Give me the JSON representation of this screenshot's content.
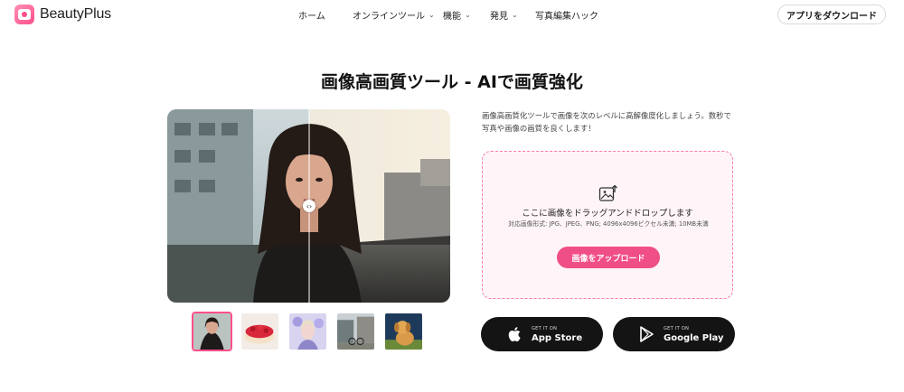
{
  "header": {
    "brand": "BeautyPlus",
    "nav": [
      {
        "label": "ホーム",
        "dropdown": false
      },
      {
        "label": "オンラインツール",
        "dropdown": true
      },
      {
        "label": "機能",
        "dropdown": true
      },
      {
        "label": "発見",
        "dropdown": true
      },
      {
        "label": "写真編集ハック",
        "dropdown": false
      }
    ],
    "download_label": "アプリをダウンロード"
  },
  "title": "画像高画質ツール - AIで画質強化",
  "description": "画像高画質化ツールで画像を次のレベルに高解像度化しましょう。数秒で写真や画像の画質を良くします！",
  "upload": {
    "drop_text": "ここに画像をドラッグアンドドロップします",
    "formats": "対応画像形式: JPG、JPEG、PNG; 4096x4096ピクセル未満; 10MB未満",
    "button_label": "画像をアップロード"
  },
  "stores": {
    "apple": {
      "small": "GET IT ON",
      "big": "App Store"
    },
    "google": {
      "small": "GET IT ON",
      "big": "Google Play"
    }
  },
  "colors": {
    "accent": "#f04e86",
    "upload_border": "#ff7ca3",
    "upload_bg": "#fff5f8",
    "store_bg": "#141414"
  },
  "icons": {
    "compare_handle": "left-right-arrows-icon",
    "upload": "image-upload-icon",
    "apple": "apple-icon",
    "google": "google-play-icon"
  }
}
